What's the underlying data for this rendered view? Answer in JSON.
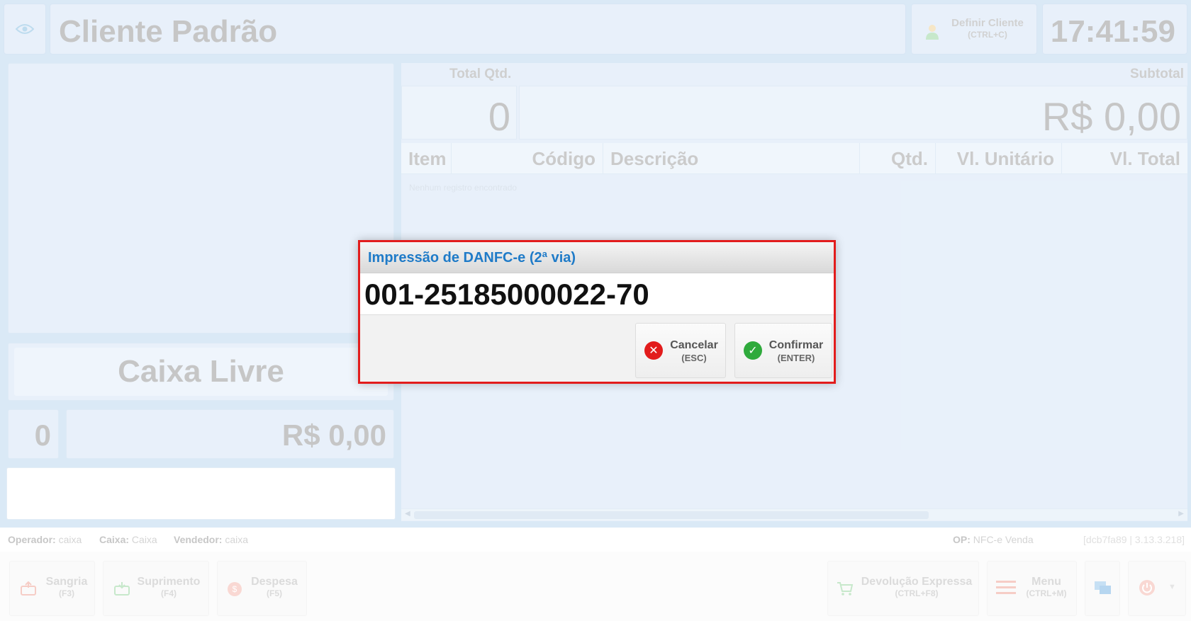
{
  "header": {
    "client_name": "Cliente Padrão",
    "define_client_label": "Definir Cliente",
    "define_client_shortcut": "(CTRL+C)",
    "clock": "17:41:59"
  },
  "left": {
    "status": "Caixa Livre",
    "count": "0",
    "total": "R$ 0,00"
  },
  "summary": {
    "qty_label": "Total Qtd.",
    "qty_value": "0",
    "subtotal_label": "Subtotal",
    "subtotal_value": "R$ 0,00"
  },
  "table": {
    "columns": [
      "Item",
      "Código",
      "Descrição",
      "Qtd.",
      "Vl. Unitário",
      "Vl. Total"
    ],
    "empty_message": "Nenhum registro encontrado"
  },
  "statusbar": {
    "operador_label": "Operador:",
    "operador_value": "caixa",
    "caixa_label": "Caixa:",
    "caixa_value": "Caixa",
    "vendedor_label": "Vendedor:",
    "vendedor_value": "caixa",
    "op_label": "OP:",
    "op_value": "NFC-e Venda",
    "version": "[dcb7fa89 | 3.13.3.218]"
  },
  "footer": {
    "sangria": {
      "label": "Sangria",
      "shortcut": "(F3)"
    },
    "suprimento": {
      "label": "Suprimento",
      "shortcut": "(F4)"
    },
    "despesa": {
      "label": "Despesa",
      "shortcut": "(F5)"
    },
    "devolucao": {
      "label": "Devolução Expressa",
      "shortcut": "(CTRL+F8)"
    },
    "menu": {
      "label": "Menu",
      "shortcut": "(CTRL+M)"
    }
  },
  "dialog": {
    "title": "Impressão de DANFC-e (2ª via)",
    "number": "001-25185000022-70",
    "cancel_label": "Cancelar",
    "cancel_shortcut": "(ESC)",
    "confirm_label": "Confirmar",
    "confirm_shortcut": "(ENTER)"
  },
  "colors": {
    "accent": "#1f7bc8",
    "dialog_border": "#e21c1c",
    "cancel_icon": "#e21c1c",
    "confirm_icon": "#2faa3c"
  }
}
